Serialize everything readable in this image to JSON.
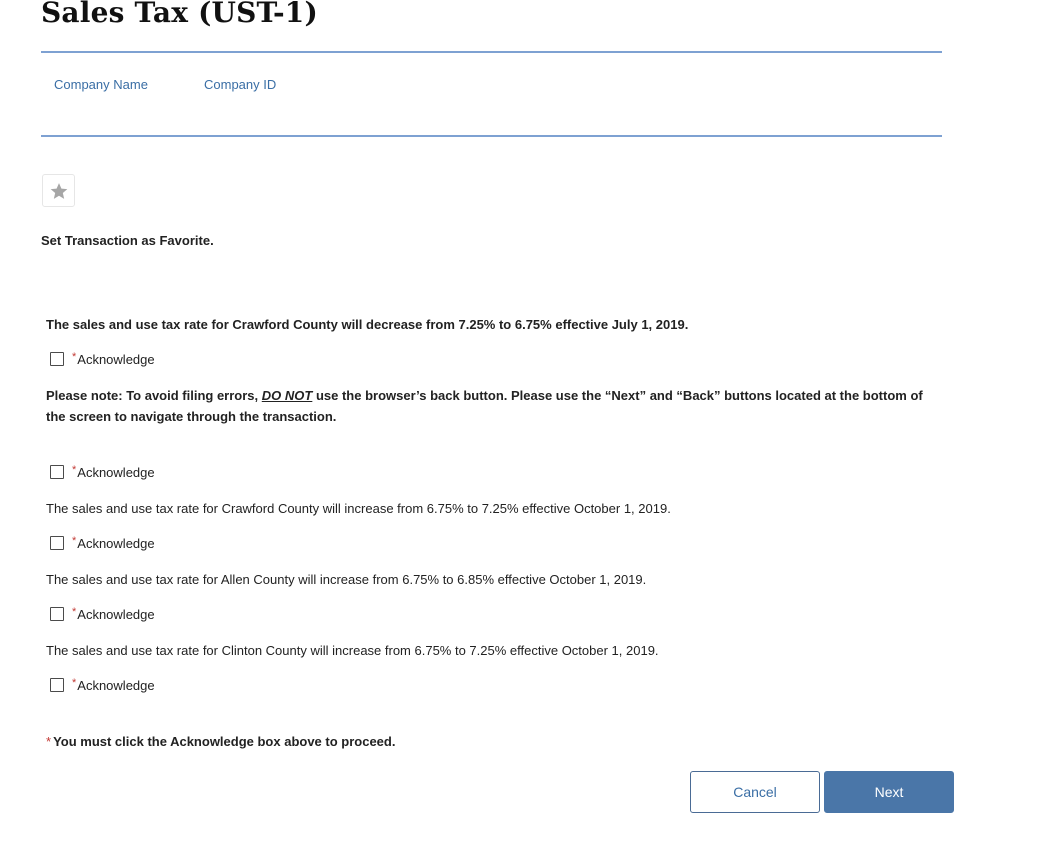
{
  "page": {
    "title": "Sales Tax (UST-1)"
  },
  "company": {
    "name_label": "Company Name",
    "id_label": "Company ID"
  },
  "favorite": {
    "icon": "star-icon",
    "label": "Set Transaction as Favorite."
  },
  "notices": {
    "crawford_decrease": "The sales and use tax rate for Crawford County will decrease from 7.25% to 6.75% effective July 1, 2019.",
    "back_button_prefix": "Please note:  To avoid filing errors, ",
    "back_button_emphasis": "DO NOT",
    "back_button_suffix": " use the browser’s back button.  Please use the “Next” and “Back” buttons located at the bottom of the screen to navigate through the transaction.",
    "crawford_increase": "The sales and use tax rate for Crawford County will increase from 6.75% to 7.25% effective October 1, 2019.",
    "allen_increase": "The sales and use tax rate for Allen County will increase from 6.75% to 6.85% effective October 1, 2019.",
    "clinton_increase": "The sales and use tax rate for Clinton County will increase from 6.75% to 7.25% effective October 1, 2019."
  },
  "acknowledge": {
    "required_marker": "*",
    "label": "Acknowledge"
  },
  "proceed_message": {
    "required_marker": "*",
    "text": "You must click the Acknowledge box above to proceed."
  },
  "buttons": {
    "cancel": "Cancel",
    "next": "Next"
  },
  "colors": {
    "accent": "#4a76a8",
    "link": "#3a6ea5",
    "required": "#c23934",
    "divider": "#7ea1d2"
  }
}
